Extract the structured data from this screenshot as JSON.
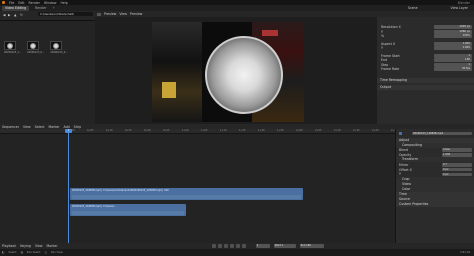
{
  "app": {
    "title": "Blender",
    "menus": [
      "File",
      "Edit",
      "Render",
      "Window",
      "Help"
    ],
    "workspace_tabs": [
      "Video Editing",
      "Render"
    ],
    "active_tab": "Video Editing"
  },
  "file_browser": {
    "path": "C:\\Users\\Lin\\Video\\Inhalt\\",
    "files": [
      {
        "name": "20200123_1...",
        "kind": "video-thumbnail"
      },
      {
        "name": "20200123_0...",
        "kind": "video-thumbnail"
      },
      {
        "name": "20200123_0...",
        "kind": "video-thumbnail"
      }
    ]
  },
  "preview": {
    "view_mode": "Preview",
    "menus": [
      "View",
      "Preview"
    ]
  },
  "properties": {
    "scene_label": "Scene",
    "view_layer": "View Layer",
    "rows": [
      {
        "label": "Resolution X",
        "value": "1920 px"
      },
      {
        "label": "Y",
        "value": "1080 px"
      },
      {
        "label": "%",
        "value": "100%"
      },
      {
        "label": "Aspect X",
        "value": "1.000"
      },
      {
        "label": "Y",
        "value": "1.000"
      },
      {
        "label": "Frame Start",
        "value": "1"
      },
      {
        "label": "End",
        "value": "160"
      },
      {
        "label": "Step",
        "value": "1"
      },
      {
        "label": "Frame Rate",
        "value": "30 fps"
      }
    ],
    "sections": [
      "Time Remapping",
      "Output"
    ]
  },
  "sequencer": {
    "menus": [
      "Sequencer",
      "View",
      "Select",
      "Marker",
      "Add",
      "Strip"
    ],
    "current_frame": "1",
    "ruler_ticks": [
      "0+00",
      "0+05",
      "0+10",
      "0+15",
      "0+20",
      "0+25",
      "1+00",
      "1+05",
      "1+10",
      "1+15",
      "1+20",
      "1+25",
      "2+00",
      "2+05",
      "2+10",
      "2+15",
      "2+20",
      "2+25",
      "3+00"
    ],
    "strips": [
      {
        "label": "20200123_118838.mp4 | C:\\Users\\Lin\\Video\\Inhalt\\20200123_118838.mp4 | 160"
      },
      {
        "label": "20200123_118838.mp4 | C:\\Users\\..."
      }
    ]
  },
  "strip_sidebar": {
    "strip_name": "20200123_118838.mp4",
    "sections": [
      "Adjust",
      "Compositing",
      "Transform",
      "Crop",
      "Video",
      "Color",
      "Time",
      "Source",
      "Custom Properties"
    ],
    "rows": [
      {
        "label": "Blend",
        "value": "Cross"
      },
      {
        "label": "Opacity",
        "value": "1.000"
      },
      {
        "label": "Mirror",
        "value": "X  Y"
      },
      {
        "label": "Offset X",
        "value": "0 px"
      },
      {
        "label": "Y",
        "value": "0 px"
      }
    ]
  },
  "transport": {
    "playback": "Playback",
    "keying": "Keying",
    "view": "View",
    "marker": "Marker",
    "frame": "1",
    "start": "Start 1",
    "end": "End 160"
  },
  "status": {
    "left": "Select",
    "mid": "Box Select",
    "right": "Pan View",
    "version": "2.81.16"
  }
}
